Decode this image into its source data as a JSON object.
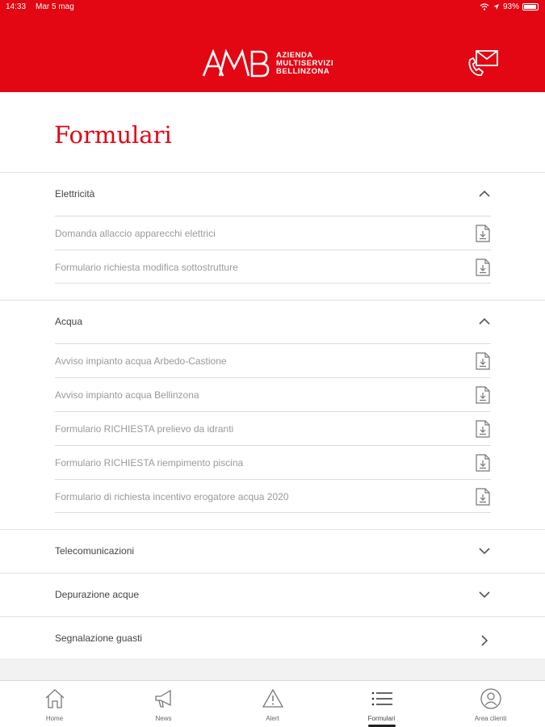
{
  "status_bar": {
    "time": "14:33",
    "date": "Mar 5 mag",
    "battery": "93%"
  },
  "brand": {
    "logo_text": "AMB",
    "line1": "AZIENDA",
    "line2": "MULTISERVIZI",
    "line3": "BELLINZONA",
    "color": "#e30613"
  },
  "page_title": "Formulari",
  "sections": [
    {
      "label": "Elettricità",
      "expanded": true,
      "items": [
        {
          "label": "Domanda allaccio apparecchi elettrici"
        },
        {
          "label": "Formulario richiesta modifica sottostrutture"
        }
      ]
    },
    {
      "label": "Acqua",
      "expanded": true,
      "items": [
        {
          "label": "Avviso impianto acqua Arbedo-Castione"
        },
        {
          "label": "Avviso impianto acqua Bellinzona"
        },
        {
          "label": "Formulario RICHIESTA prelievo da idranti"
        },
        {
          "label": "Formulario RICHIESTA riempimento piscina"
        },
        {
          "label": "Formulario di richiesta incentivo erogatore acqua 2020"
        }
      ]
    },
    {
      "label": "Telecomunicazioni",
      "expanded": false
    },
    {
      "label": "Depurazione acque",
      "expanded": false
    },
    {
      "label": "Segnalazione guasti",
      "link": true
    }
  ],
  "tabs": [
    {
      "label": "Home",
      "icon": "home-icon"
    },
    {
      "label": "News",
      "icon": "megaphone-icon"
    },
    {
      "label": "Alert",
      "icon": "warning-icon"
    },
    {
      "label": "Formulari",
      "icon": "list-icon",
      "active": true
    },
    {
      "label": "Area clienti",
      "icon": "user-icon"
    }
  ]
}
